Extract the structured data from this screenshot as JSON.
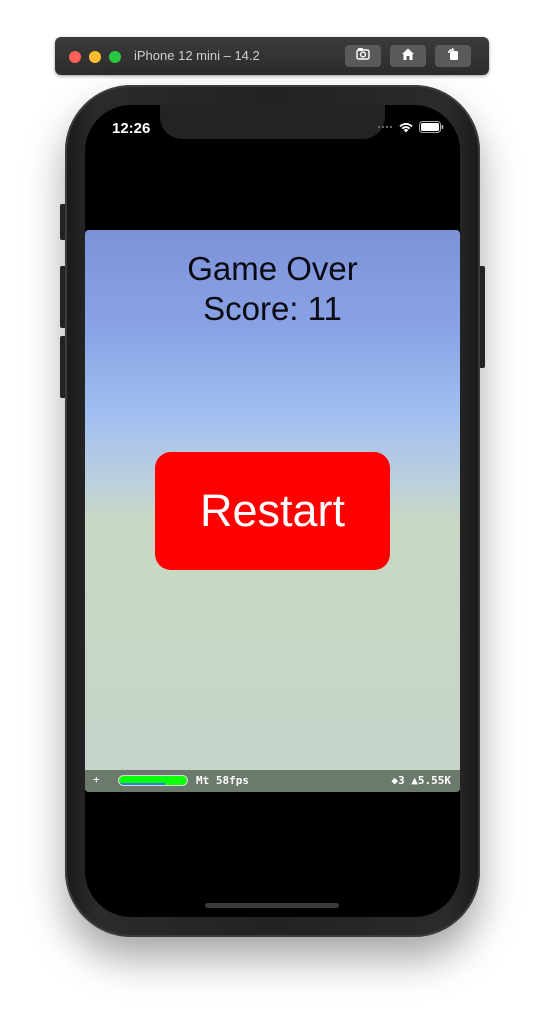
{
  "simulator": {
    "title": "iPhone 12 mini – 14.2",
    "buttons": {
      "screenshot_icon": "camera-icon",
      "home_icon": "home-icon",
      "rotate_icon": "rotate-icon"
    }
  },
  "status_bar": {
    "time": "12:26",
    "icons": [
      "cellular-dots-icon",
      "wifi-icon",
      "battery-icon"
    ]
  },
  "game": {
    "game_over_text": "Game Over",
    "score_text": "Score: 11",
    "restart_label": "Restart",
    "colors": {
      "restart_bg": "#ff0000",
      "sky_top": "#7d92d9",
      "ground": "#c8d7c6"
    }
  },
  "stats": {
    "plus": "+",
    "meter_fill": 1.0,
    "cpu_line_fill": 0.68,
    "fps_text": "Mt 58fps",
    "right_text": "◆3 ▲5.55K",
    "meter_color": "#0aff0a"
  }
}
